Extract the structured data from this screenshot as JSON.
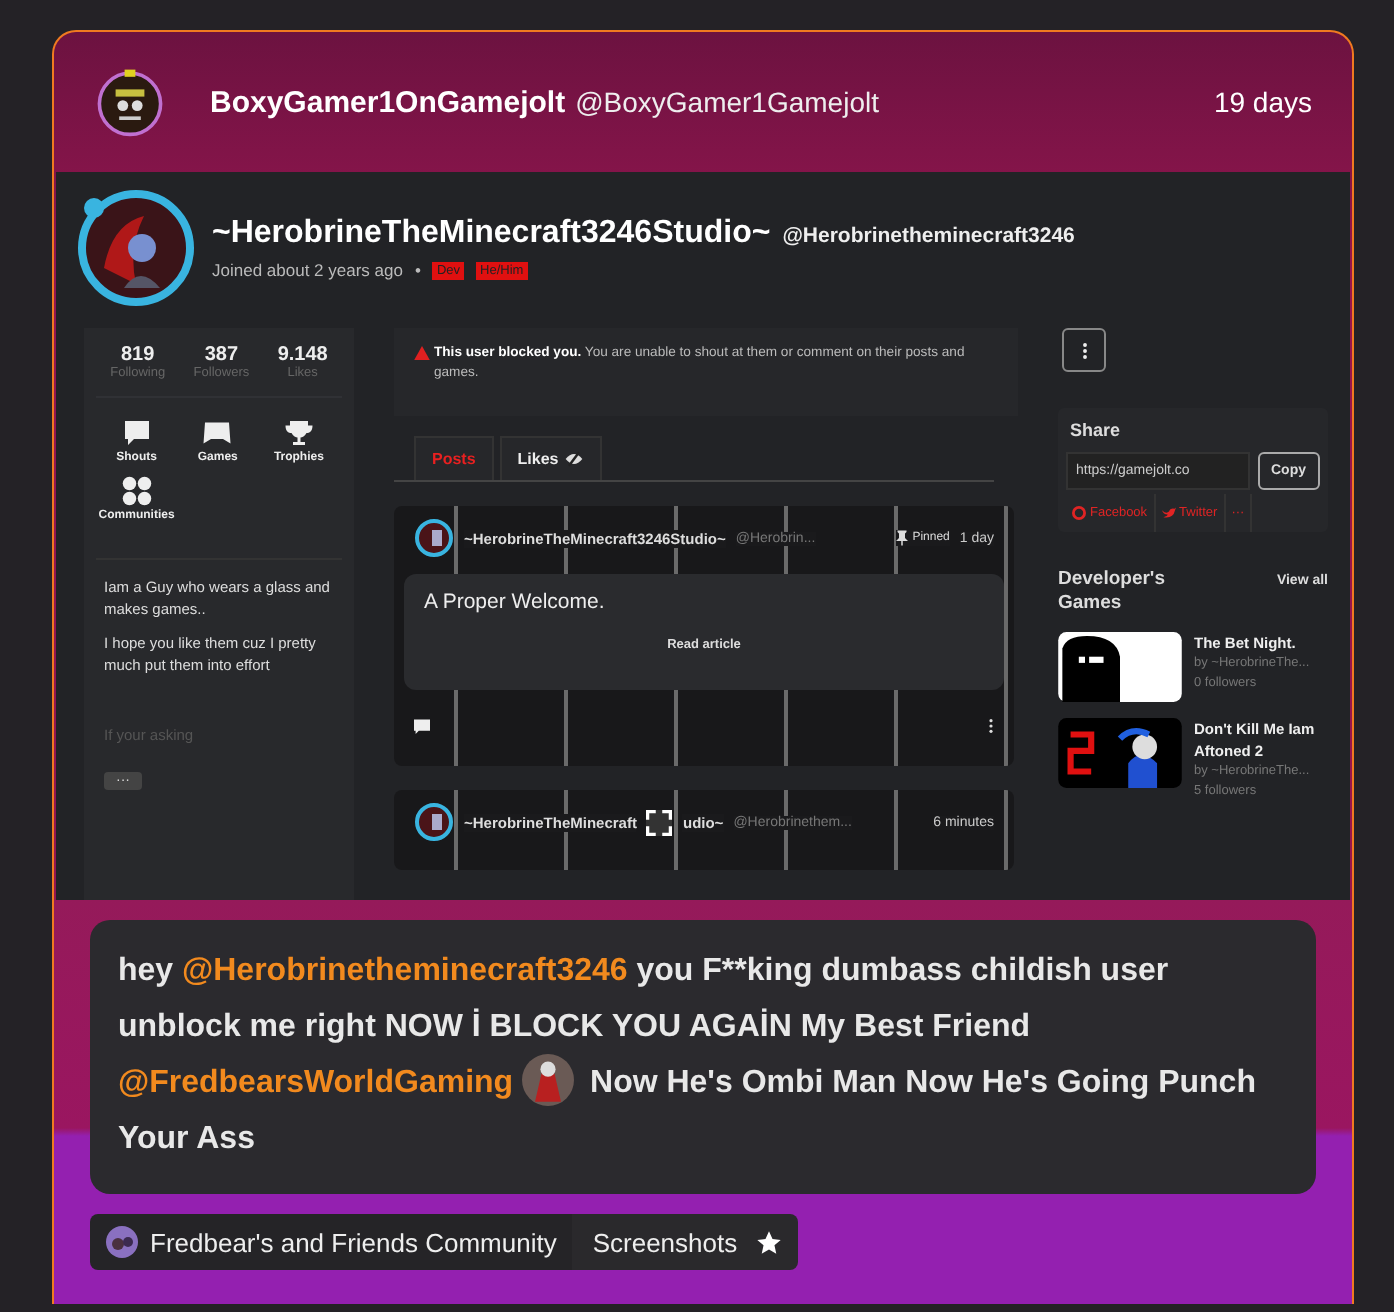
{
  "post": {
    "author": {
      "name": "BoxyGamer1OnGamejolt",
      "handle": "@BoxyGamer1Gamejolt"
    },
    "time": "19 days"
  },
  "screenshot": {
    "profile": {
      "name": "~HerobrineTheMinecraft3246Studio~",
      "handle": "@Herobrinetheminecraft3246",
      "joined": "Joined about 2 years ago",
      "separator": "•",
      "tags": [
        "Dev",
        "He/Him"
      ]
    },
    "stats": [
      {
        "value": "819",
        "label": "Following"
      },
      {
        "value": "387",
        "label": "Followers"
      },
      {
        "value": "9.148",
        "label": "Likes"
      }
    ],
    "nav": [
      {
        "label": "Shouts"
      },
      {
        "label": "Games"
      },
      {
        "label": "Trophies"
      },
      {
        "label": "Communities"
      }
    ],
    "bio": [
      "Iam a Guy who wears a glass and makes games..",
      "I hope you like them cuz I pretty much put them into effort"
    ],
    "bio_more": "If your asking",
    "more_button": "···",
    "notice": "**This user blocked you.** You are unable to shout at them or comment on their posts and games.",
    "tabs": [
      {
        "label": "Posts",
        "selected": true
      },
      {
        "label": "Likes",
        "selected": false
      }
    ],
    "posts": [
      {
        "name": "~HerobrineTheMinecraft3246Studio~",
        "handle": "@Herobrin...",
        "pinned": "Pinned",
        "time": "1 day",
        "title": "A Proper Welcome.",
        "action": "Read article"
      },
      {
        "name": "~HerobrineTheMinecraft",
        "name_rest": "udio~",
        "handle": "@Herobrinethem...",
        "time": "6 minutes"
      }
    ],
    "share": {
      "title": "Share",
      "url": "https://gamejolt.co",
      "copy": "Copy",
      "links": [
        {
          "label": "Facebook"
        },
        {
          "label": "Twitter"
        },
        {
          "label": "···"
        }
      ]
    },
    "dev_games": {
      "title": "Developer's Games",
      "view_all": "View all",
      "games": [
        {
          "title": "The Bet Night.",
          "by": "by ~HerobrineThe...",
          "followers": "0 followers"
        },
        {
          "title": "Don't Kill Me Iam Aftoned 2",
          "by": "by ~HerobrineThe...",
          "followers": "5 followers"
        }
      ]
    }
  },
  "message": [
    {
      "kind": "text",
      "text": "hey "
    },
    {
      "kind": "mention",
      "text": "@Herobrinetheminecraft3246"
    },
    {
      "kind": "text",
      "text": " you F**king dumbass childish user unblock me right NOW İ BLOCK YOU AGAİN My Best Friend "
    },
    {
      "kind": "mention",
      "text": "@FredbearsWorldGaming"
    },
    {
      "kind": "avatar"
    },
    {
      "kind": "text",
      "text": " Now He's Ombi Man Now He's Going Punch Your Ass"
    }
  ],
  "tags": [
    {
      "kind": "community",
      "label": "Fredbear's and Friends Community"
    },
    {
      "kind": "channel",
      "label": "Screenshots"
    }
  ]
}
